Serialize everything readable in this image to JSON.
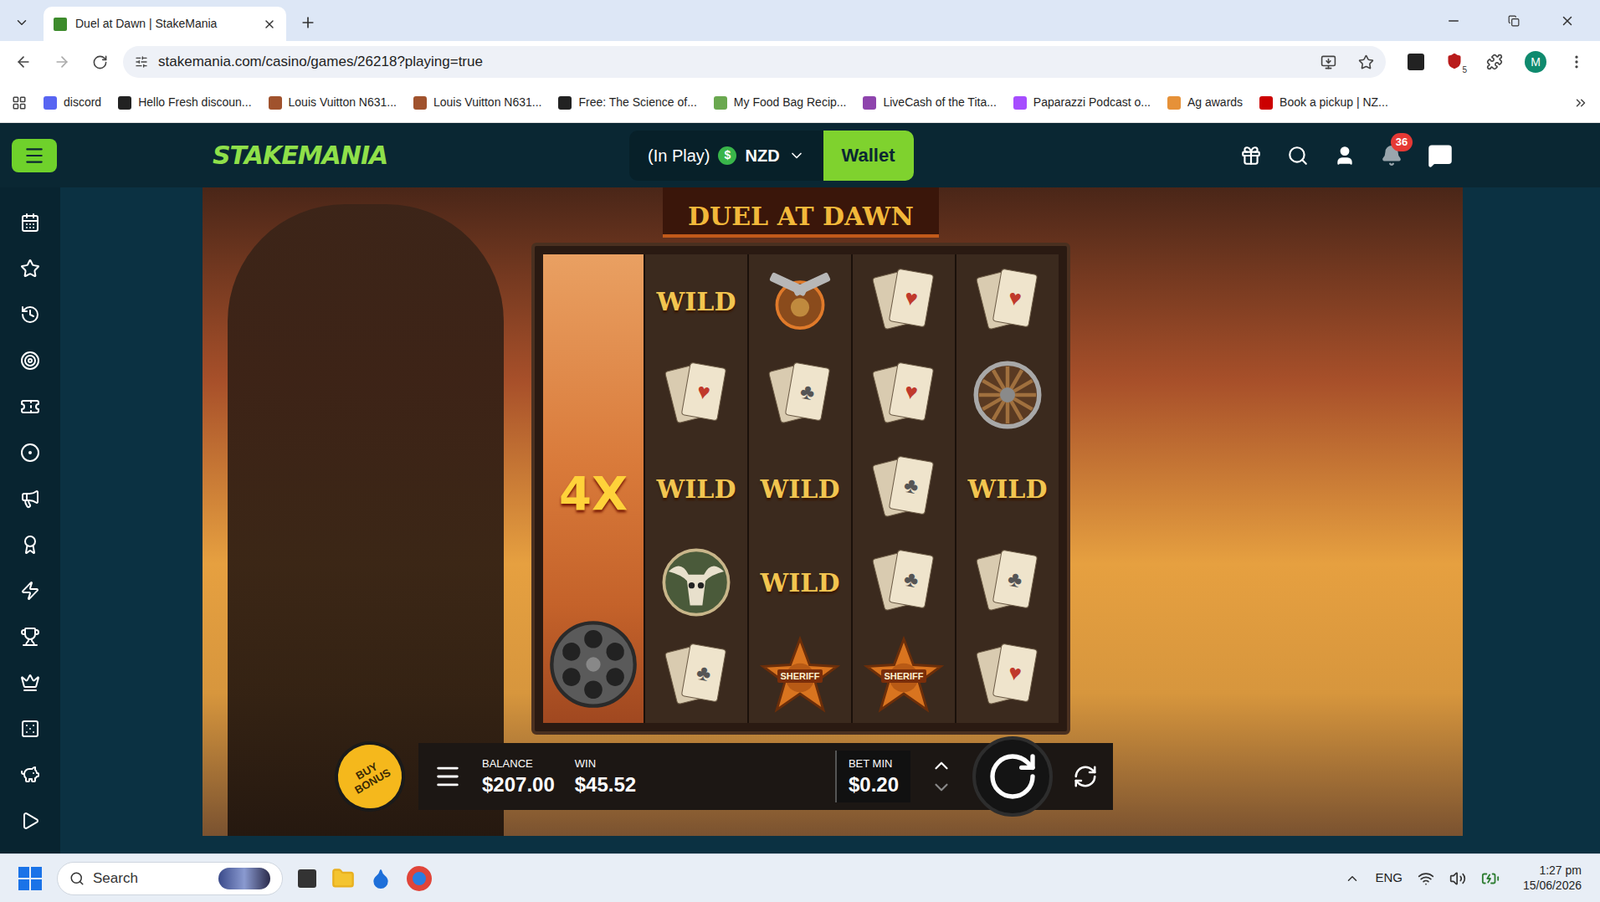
{
  "browser": {
    "tabs": [
      {
        "label": "Duel at Dawn | StakeMania",
        "selected": true
      }
    ],
    "address": "stakemania.com/casino/games/26218?playing=true",
    "extension_badge": "5",
    "profile_initial": "M",
    "bookmarks": [
      {
        "label": "discord",
        "color": "#5865f2"
      },
      {
        "label": "Hello Fresh discoun...",
        "color": "#222222"
      },
      {
        "label": "Louis Vuitton N631...",
        "color": "#a0522d"
      },
      {
        "label": "Louis Vuitton N631...",
        "color": "#a0522d"
      },
      {
        "label": "Free: The Science of...",
        "color": "#222222"
      },
      {
        "label": "My Food Bag Recip...",
        "color": "#6aa84f"
      },
      {
        "label": "LiveCash of the Tita...",
        "color": "#8e44ad"
      },
      {
        "label": "Paparazzi Podcast o...",
        "color": "#a64dff"
      },
      {
        "label": "Ag awards",
        "color": "#e69138"
      },
      {
        "label": "Book a pickup | NZ...",
        "color": "#cc0000"
      }
    ]
  },
  "site": {
    "logo": "STAKEMANIA",
    "balance": {
      "status": "(In Play)",
      "symbol": "$",
      "currency": "NZD"
    },
    "wallet": "Wallet",
    "notifications": "36"
  },
  "game": {
    "title": "DUEL AT DAWN",
    "multiplier": "4X",
    "reels": [
      [
        {
          "kind": "wild",
          "label": "WILD"
        },
        {
          "kind": "card",
          "label": "♥",
          "color": "#c0392b"
        },
        {
          "kind": "wild",
          "label": "WILD"
        },
        {
          "kind": "skull"
        },
        {
          "kind": "card",
          "label": "♣",
          "color": "#555555"
        }
      ],
      [
        {
          "kind": "guns"
        },
        {
          "kind": "card",
          "label": "♣",
          "color": "#555555"
        },
        {
          "kind": "wild",
          "label": "WILD"
        },
        {
          "kind": "wild",
          "label": "WILD"
        },
        {
          "kind": "sheriff",
          "label": "SHERIFF"
        }
      ],
      [
        {
          "kind": "card",
          "label": "♥",
          "color": "#c0392b"
        },
        {
          "kind": "card",
          "label": "♥",
          "color": "#c0392b"
        },
        {
          "kind": "card",
          "label": "♣",
          "color": "#555555"
        },
        {
          "kind": "card",
          "label": "♣",
          "color": "#555555"
        },
        {
          "kind": "sheriff",
          "label": "SHERIFF"
        }
      ],
      [
        {
          "kind": "card",
          "label": "♥",
          "color": "#c0392b"
        },
        {
          "kind": "wheel"
        },
        {
          "kind": "wild",
          "label": "WILD"
        },
        {
          "kind": "card",
          "label": "♣",
          "color": "#555555"
        },
        {
          "kind": "card",
          "label": "♥",
          "color": "#c0392b"
        }
      ]
    ],
    "buy_bonus": "BUY BONUS",
    "balance_label": "BALANCE",
    "balance": "$207.00",
    "win_label": "WIN",
    "win": "$45.52",
    "bet_label": "BET MIN",
    "bet": "$0.20"
  },
  "taskbar": {
    "search": "Search",
    "language": "ENG",
    "time": "1:27 pm",
    "date": "15/06/2026"
  }
}
